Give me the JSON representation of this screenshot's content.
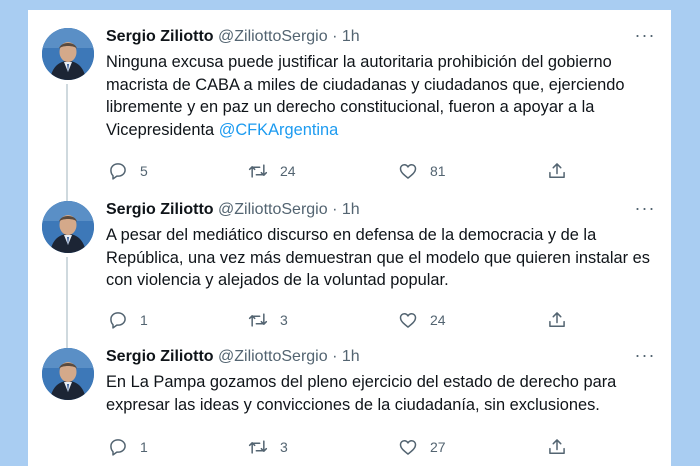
{
  "tweets": [
    {
      "author": {
        "name": "Sergio Ziliotto",
        "handle": "@ZiliottoSergio",
        "separator": "·",
        "time": "1h"
      },
      "text": "Ninguna excusa puede justificar la autoritaria prohibición del gobierno macrista de CABA a miles de ciudadanas y ciudadanos que, ejerciendo libremente y en paz un derecho constitucional, fueron a apoyar a la Vicepresidenta ",
      "mention": "@CFKArgentina",
      "replies": "5",
      "retweets": "24",
      "likes": "81"
    },
    {
      "author": {
        "name": "Sergio Ziliotto",
        "handle": "@ZiliottoSergio",
        "separator": "·",
        "time": "1h"
      },
      "text": "A pesar del mediático discurso en defensa de la democracia y de la República, una vez más demuestran que el modelo que quieren instalar es con violencia y alejados de la voluntad popular.",
      "mention": "",
      "replies": "1",
      "retweets": "3",
      "likes": "24"
    },
    {
      "author": {
        "name": "Sergio Ziliotto",
        "handle": "@ZiliottoSergio",
        "separator": "·",
        "time": "1h"
      },
      "text": "En La Pampa gozamos del pleno ejercicio del estado de derecho para expresar las ideas y convicciones de la ciudadanía, sin exclusiones.",
      "mention": "",
      "replies": "1",
      "retweets": "3",
      "likes": "27"
    }
  ],
  "icons": {
    "more": "more-horizontal-icon",
    "reply": "reply-bubble-icon",
    "retweet": "retweet-arrows-icon",
    "like": "heart-icon",
    "share": "share-upload-icon"
  },
  "colors": {
    "background": "#a9cdf2",
    "card": "#ffffff",
    "text": "#0f1419",
    "secondary": "#536471",
    "link": "#1d9bf0",
    "thread_line": "#cfd9de"
  }
}
